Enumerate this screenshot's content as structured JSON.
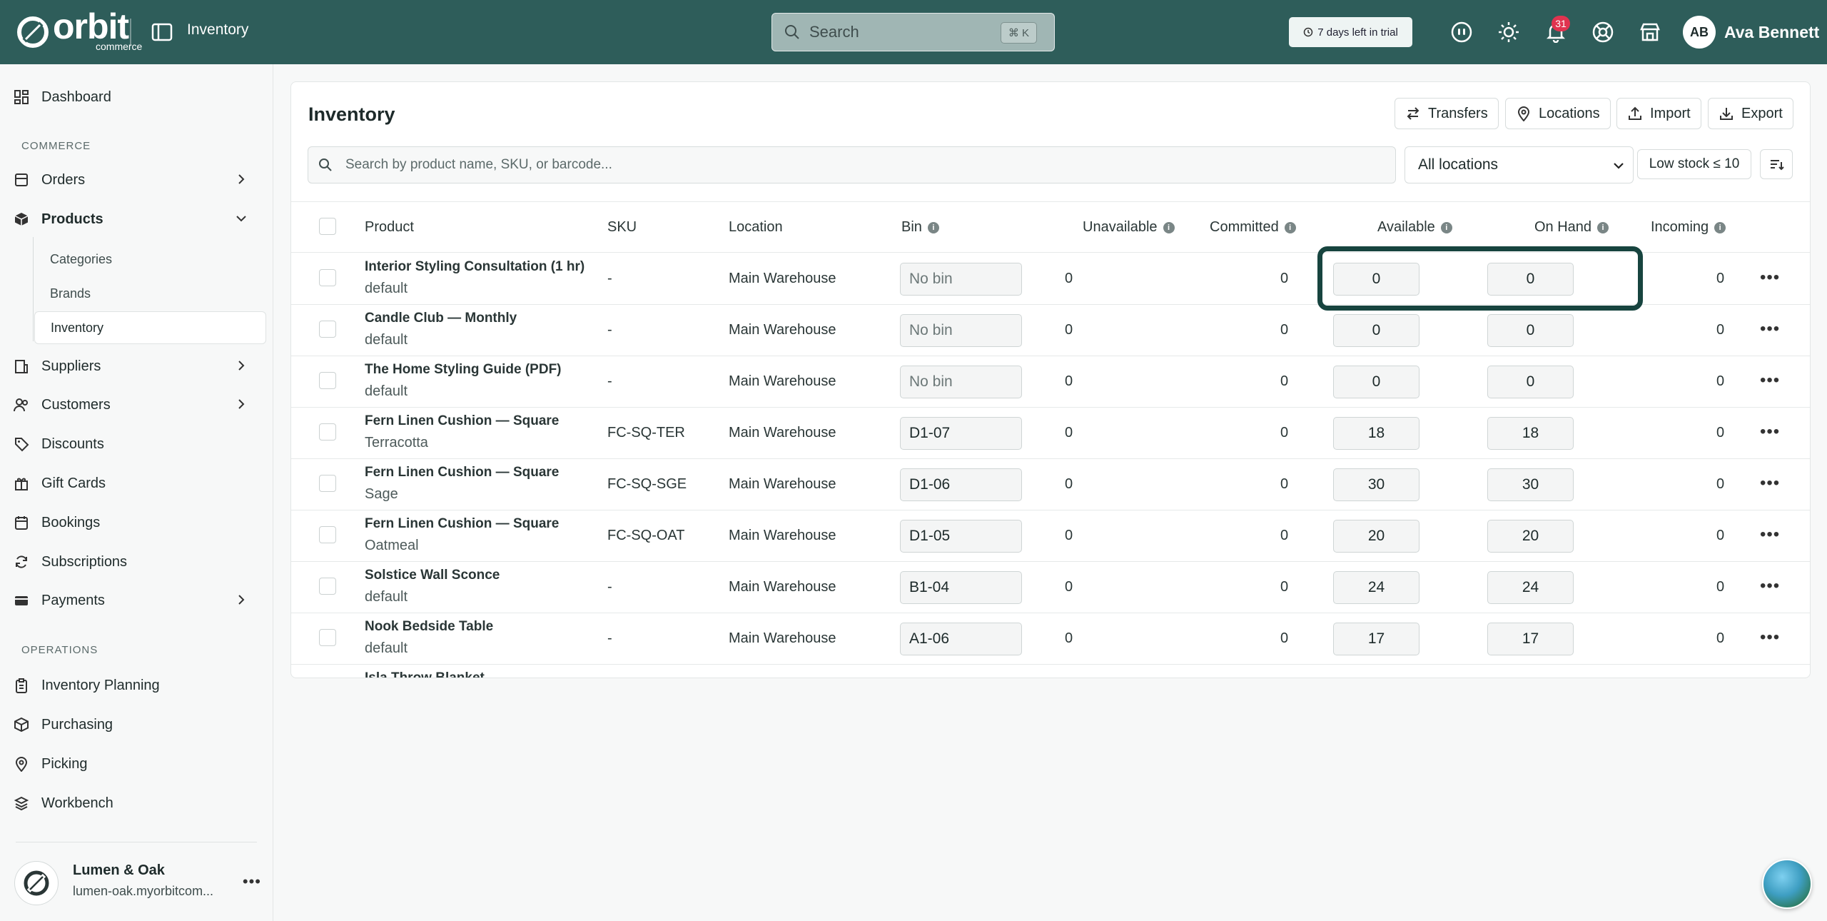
{
  "topbar": {
    "brand_name": "orbit",
    "brand_sub": "commerce",
    "title": "Inventory",
    "search_placeholder": "Search",
    "search_shortcut": "⌘ K",
    "trial_text": "7 days left in trial",
    "notification_count": "31",
    "user_initials": "AB",
    "user_name": "Ava Bennett",
    "bg_color": "#2e5d5a"
  },
  "sidebar": {
    "dashboard": "Dashboard",
    "section_commerce": "COMMERCE",
    "orders": "Orders",
    "products": "Products",
    "sub_items": [
      "Categories",
      "Brands",
      "Inventory"
    ],
    "suppliers": "Suppliers",
    "customers": "Customers",
    "discounts": "Discounts",
    "gift_cards": "Gift Cards",
    "bookings": "Bookings",
    "subscriptions": "Subscriptions",
    "payments": "Payments",
    "section_operations": "OPERATIONS",
    "inventory_planning": "Inventory Planning",
    "purchasing": "Purchasing",
    "picking": "Picking",
    "workbench": "Workbench",
    "store_name": "Lumen & Oak",
    "store_url": "lumen-oak.myorbitcom..."
  },
  "main": {
    "title": "Inventory",
    "buttons": {
      "transfers": "Transfers",
      "locations": "Locations",
      "import": "Import",
      "export": "Export"
    },
    "filter_placeholder": "Search by product name, SKU, or barcode...",
    "location_select": "All locations",
    "low_stock": "Low stock ≤ 10"
  },
  "table": {
    "columns": [
      "Product",
      "SKU",
      "Location",
      "Bin",
      "Unavailable",
      "Committed",
      "Available",
      "On Hand",
      "Incoming"
    ],
    "rows": [
      {
        "name": "Interior Styling Consultation (1 hr)",
        "variant": "default",
        "sku": "-",
        "location": "Main Warehouse",
        "bin": "No bin",
        "bin_empty": true,
        "unavailable": "0",
        "committed": "0",
        "available": "0",
        "on_hand": "0",
        "incoming": "0"
      },
      {
        "name": "Candle Club — Monthly",
        "variant": "default",
        "sku": "-",
        "location": "Main Warehouse",
        "bin": "No bin",
        "bin_empty": true,
        "unavailable": "0",
        "committed": "0",
        "available": "0",
        "on_hand": "0",
        "incoming": "0"
      },
      {
        "name": "The Home Styling Guide (PDF)",
        "variant": "default",
        "sku": "-",
        "location": "Main Warehouse",
        "bin": "No bin",
        "bin_empty": true,
        "unavailable": "0",
        "committed": "0",
        "available": "0",
        "on_hand": "0",
        "incoming": "0"
      },
      {
        "name": "Fern Linen Cushion — Square",
        "variant": "Terracotta",
        "sku": "FC-SQ-TER",
        "location": "Main Warehouse",
        "bin": "D1-07",
        "bin_empty": false,
        "unavailable": "0",
        "committed": "0",
        "available": "18",
        "on_hand": "18",
        "incoming": "0"
      },
      {
        "name": "Fern Linen Cushion — Square",
        "variant": "Sage",
        "sku": "FC-SQ-SGE",
        "location": "Main Warehouse",
        "bin": "D1-06",
        "bin_empty": false,
        "unavailable": "0",
        "committed": "0",
        "available": "30",
        "on_hand": "30",
        "incoming": "0"
      },
      {
        "name": "Fern Linen Cushion — Square",
        "variant": "Oatmeal",
        "sku": "FC-SQ-OAT",
        "location": "Main Warehouse",
        "bin": "D1-05",
        "bin_empty": false,
        "unavailable": "0",
        "committed": "0",
        "available": "20",
        "on_hand": "20",
        "incoming": "0"
      },
      {
        "name": "Solstice Wall Sconce",
        "variant": "default",
        "sku": "-",
        "location": "Main Warehouse",
        "bin": "B1-04",
        "bin_empty": false,
        "unavailable": "0",
        "committed": "0",
        "available": "24",
        "on_hand": "24",
        "incoming": "0"
      },
      {
        "name": "Nook Bedside Table",
        "variant": "default",
        "sku": "-",
        "location": "Main Warehouse",
        "bin": "A1-06",
        "bin_empty": false,
        "unavailable": "0",
        "committed": "0",
        "available": "17",
        "on_hand": "17",
        "incoming": "0"
      },
      {
        "name": "Isla Throw Blanket",
        "variant": "",
        "sku": "",
        "location": "",
        "bin": "",
        "bin_empty": false,
        "unavailable": "",
        "committed": "",
        "available": "",
        "on_hand": "",
        "incoming": ""
      }
    ]
  }
}
